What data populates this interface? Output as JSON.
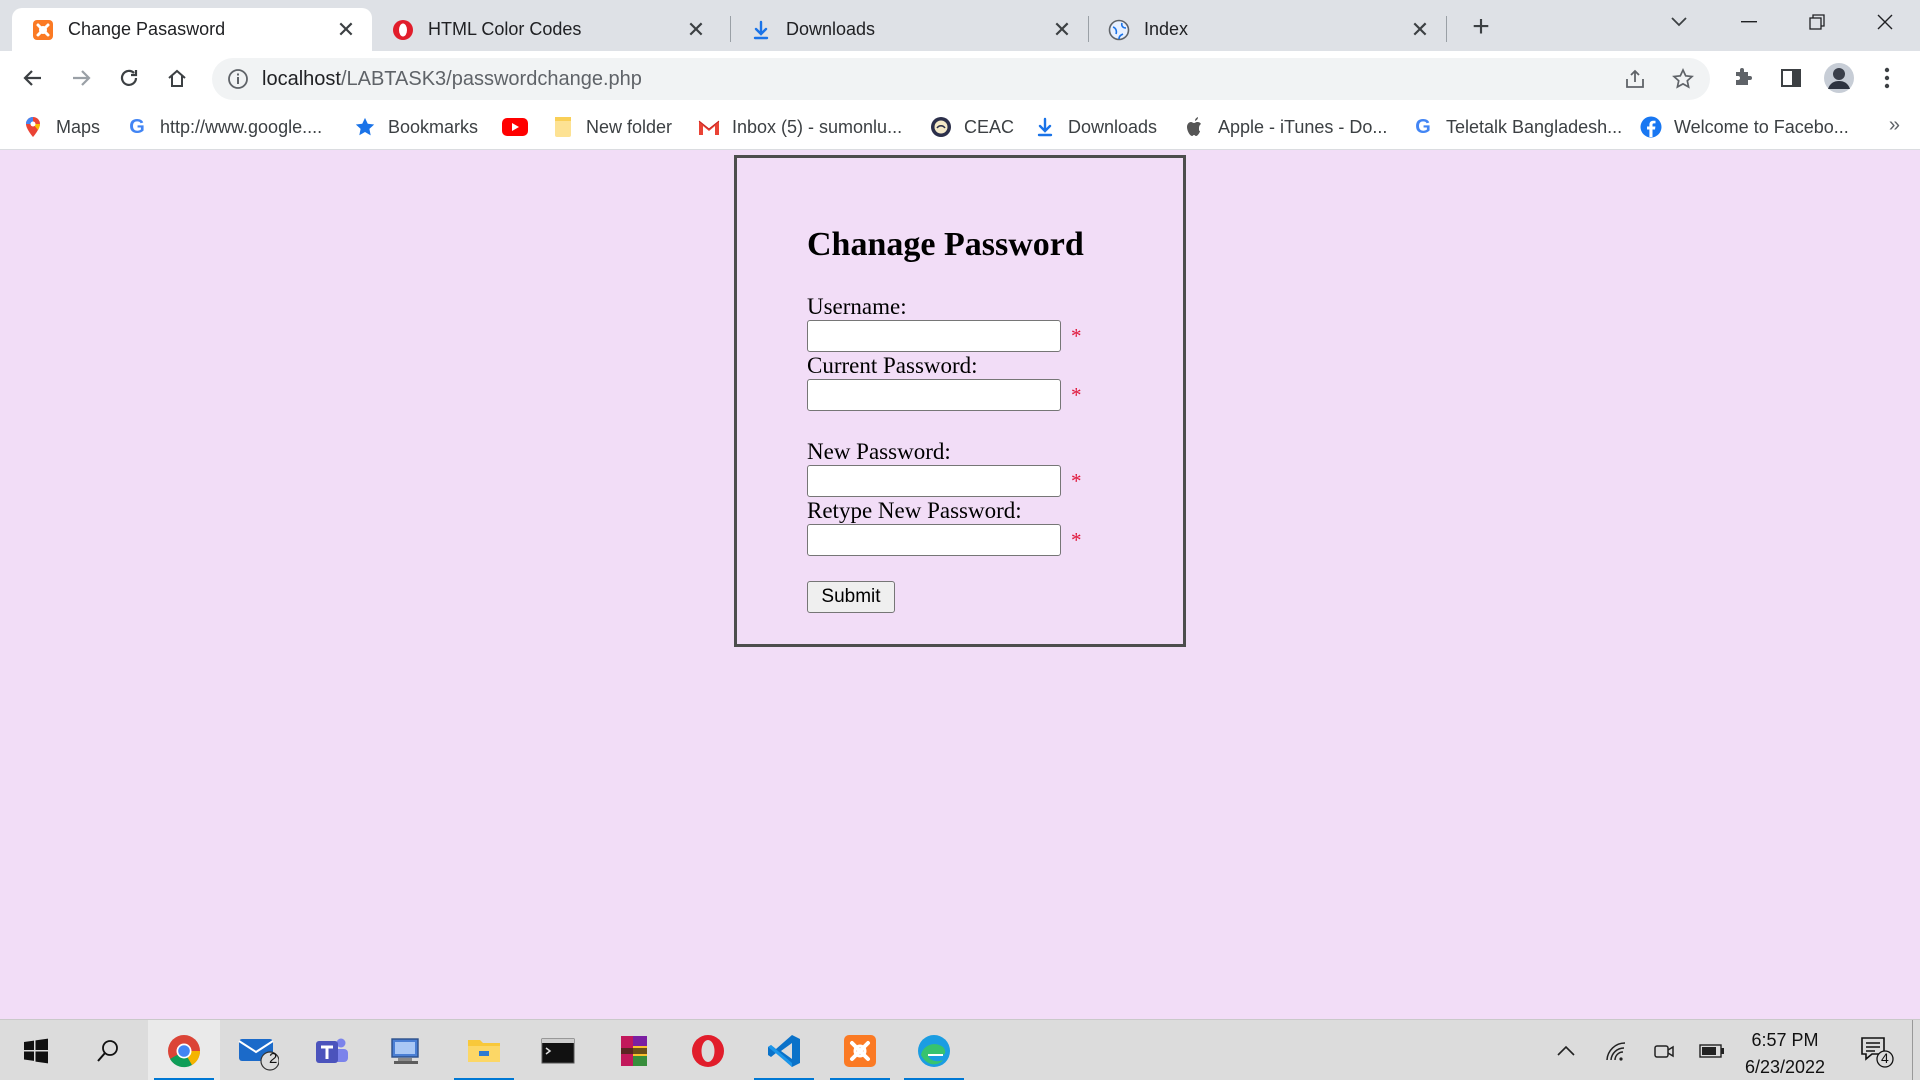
{
  "browser": {
    "tabs": [
      {
        "title": "Change Pasasword",
        "icon": "xampp-icon",
        "active": true
      },
      {
        "title": "HTML Color Codes",
        "icon": "opera-icon",
        "active": false
      },
      {
        "title": "Downloads",
        "icon": "download-icon",
        "active": false
      },
      {
        "title": "Index",
        "icon": "globe-icon",
        "active": false
      }
    ],
    "address": {
      "host": "localhost",
      "path": "/LABTASK3/passwordchange.php"
    },
    "bookmarks": [
      {
        "label": "Maps",
        "icon": "maps-pin-icon"
      },
      {
        "label": "http://www.google....",
        "icon": "google-icon"
      },
      {
        "label": "Bookmarks",
        "icon": "star-icon"
      },
      {
        "label": "",
        "icon": "youtube-icon"
      },
      {
        "label": "New folder",
        "icon": "folder-icon"
      },
      {
        "label": "Inbox (5) - sumonlu...",
        "icon": "gmail-icon"
      },
      {
        "label": "CEAC",
        "icon": "seal-icon"
      },
      {
        "label": "Downloads",
        "icon": "download-icon"
      },
      {
        "label": "Apple - iTunes - Do...",
        "icon": "apple-icon"
      },
      {
        "label": "Teletalk Bangladesh...",
        "icon": "google-icon"
      },
      {
        "label": "Welcome to Facebo...",
        "icon": "facebook-icon"
      }
    ]
  },
  "form": {
    "title": "Chanage Password",
    "fields": [
      {
        "label": "Username:",
        "value": "",
        "required_mark": "*"
      },
      {
        "label": "Current Password:",
        "value": "",
        "required_mark": "*"
      },
      {
        "label": "New Password:",
        "value": "",
        "required_mark": "*"
      },
      {
        "label": "Retype New Password:",
        "value": "",
        "required_mark": "*"
      }
    ],
    "submit_label": "Submit"
  },
  "taskbar": {
    "mail_badge": "2",
    "time": "6:57 PM",
    "date": "6/23/2022",
    "notification_count": "4"
  },
  "colors": {
    "page_background": "#f2ddf7",
    "required_mark": "#e0163a",
    "card_border": "#4d4d4d",
    "taskbar_accent": "#0078d4"
  }
}
